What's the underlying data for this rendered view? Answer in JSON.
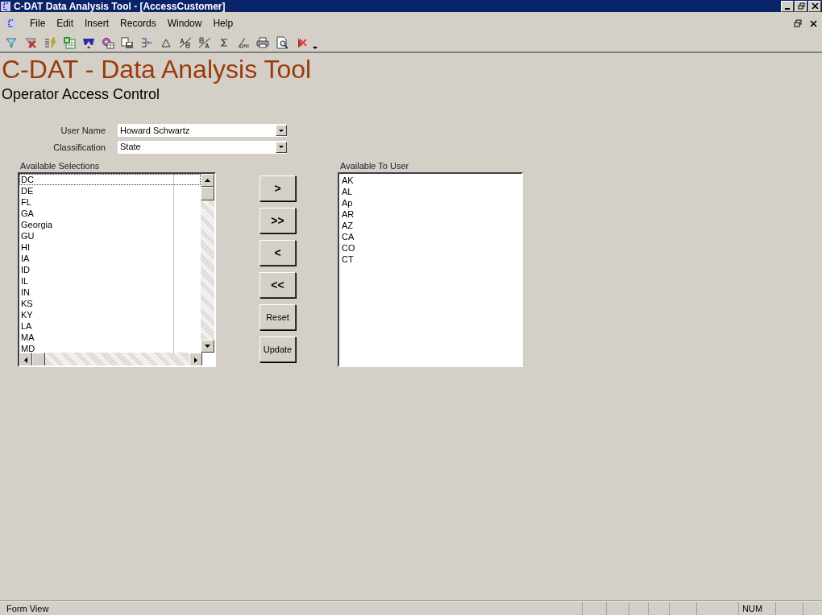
{
  "window": {
    "title": "C-DAT Data Analysis Tool - [AccessCustomer]"
  },
  "menu": [
    "File",
    "Edit",
    "Insert",
    "Records",
    "Window",
    "Help"
  ],
  "header": {
    "title": "C-DAT - Data Analysis Tool",
    "subtitle": "Operator Access Control"
  },
  "fields": [
    {
      "label": "User Name",
      "value": "Howard Schwartz"
    },
    {
      "label": "Classification",
      "value": "State"
    }
  ],
  "available_selections": {
    "label": "Available Selections",
    "items": [
      {
        "text": "DC",
        "focused": true
      },
      {
        "text": "DE",
        "focused": false
      },
      {
        "text": "FL",
        "focused": false
      },
      {
        "text": "GA",
        "focused": false
      },
      {
        "text": "Georgia",
        "focused": false
      },
      {
        "text": "GU",
        "focused": false
      },
      {
        "text": "HI",
        "focused": false
      },
      {
        "text": "IA",
        "focused": false
      },
      {
        "text": "ID",
        "focused": false
      },
      {
        "text": "IL",
        "focused": false
      },
      {
        "text": "IN",
        "focused": false
      },
      {
        "text": "KS",
        "focused": false
      },
      {
        "text": "KY",
        "focused": false
      },
      {
        "text": "LA",
        "focused": false
      },
      {
        "text": "MA",
        "focused": false
      },
      {
        "text": "MD",
        "focused": false
      }
    ]
  },
  "buttons": [
    ">",
    ">>",
    "<",
    "<<",
    "Reset",
    "Update"
  ],
  "available_to_user": {
    "label": "Available To User",
    "items": [
      "AK",
      "AL",
      "Ap",
      "AR",
      "AZ",
      "CA",
      "CO",
      "CT"
    ]
  },
  "status_bar": {
    "text": "Form View",
    "indicator": "NUM"
  }
}
